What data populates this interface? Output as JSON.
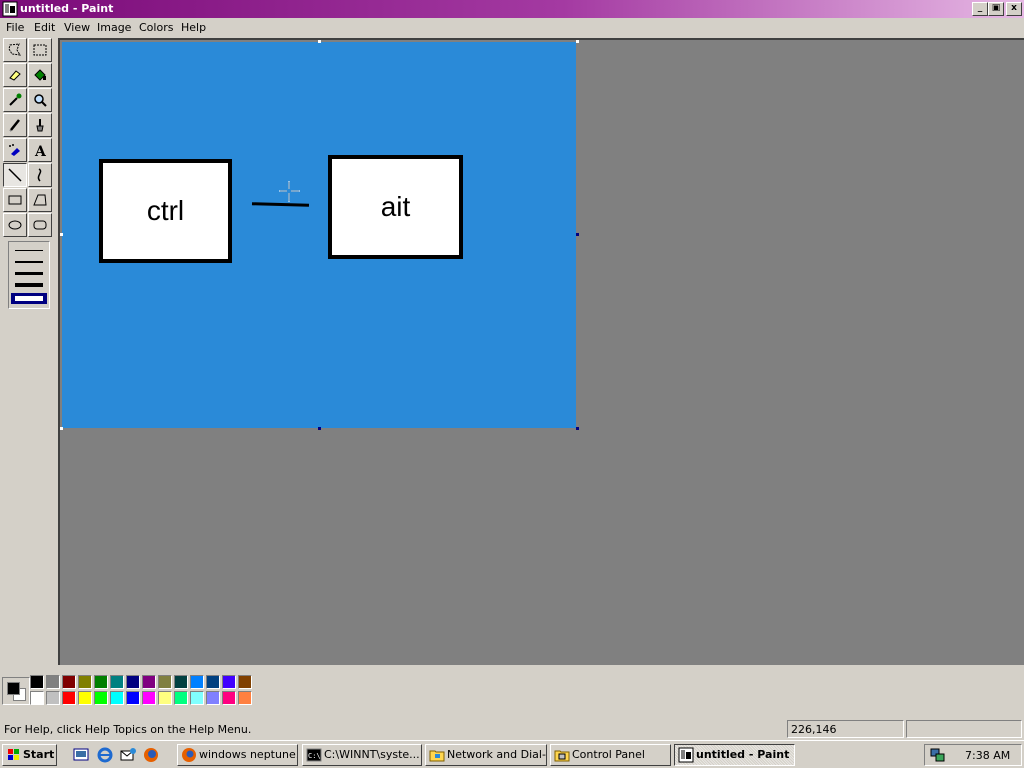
{
  "window": {
    "title": "untitled - Paint"
  },
  "window_buttons": {
    "minimize": "_",
    "maximize": "▣",
    "close": "x"
  },
  "menu": [
    "File",
    "Edit",
    "View",
    "Image",
    "Colors",
    "Help"
  ],
  "toolbox": {
    "tools": [
      "free-form-select",
      "select",
      "eraser",
      "fill-with-color",
      "pick-color",
      "magnifier",
      "pencil",
      "brush",
      "airbrush",
      "text",
      "line",
      "curve",
      "rectangle",
      "polygon",
      "ellipse",
      "rounded-rectangle"
    ],
    "selected_tool": "line",
    "line_widths": 5,
    "selected_line_width": 5
  },
  "canvas": {
    "background_color": "#2a8ad8",
    "keys": [
      {
        "label": "ctrl"
      },
      {
        "label": "ait"
      }
    ]
  },
  "palette": {
    "foreground": "#000000",
    "background": "#ffffff",
    "top_row": [
      "#000000",
      "#808080",
      "#800000",
      "#808000",
      "#008000",
      "#008080",
      "#000080",
      "#800080",
      "#808040",
      "#004040",
      "#0080ff",
      "#004080",
      "#4000ff",
      "#804000"
    ],
    "bottom_row": [
      "#ffffff",
      "#c0c0c0",
      "#ff0000",
      "#ffff00",
      "#00ff00",
      "#00ffff",
      "#0000ff",
      "#ff00ff",
      "#ffff80",
      "#00ff80",
      "#80ffff",
      "#8080ff",
      "#ff0080",
      "#ff8040"
    ]
  },
  "status": {
    "help_text": "For Help, click Help Topics on the Help Menu.",
    "coordinates": "226,146",
    "size": ""
  },
  "taskbar": {
    "start_label": "Start",
    "quick_launch": [
      "show-desktop-icon",
      "internet-explorer-icon",
      "outlook-express-icon",
      "firefox-icon"
    ],
    "buttons": [
      {
        "label": "windows neptune..."
      },
      {
        "label": "C:\\WINNT\\syste..."
      },
      {
        "label": "Network and Dial-..."
      },
      {
        "label": "Control Panel"
      },
      {
        "label": "untitled - Paint"
      }
    ],
    "clock": "7:38 AM"
  }
}
